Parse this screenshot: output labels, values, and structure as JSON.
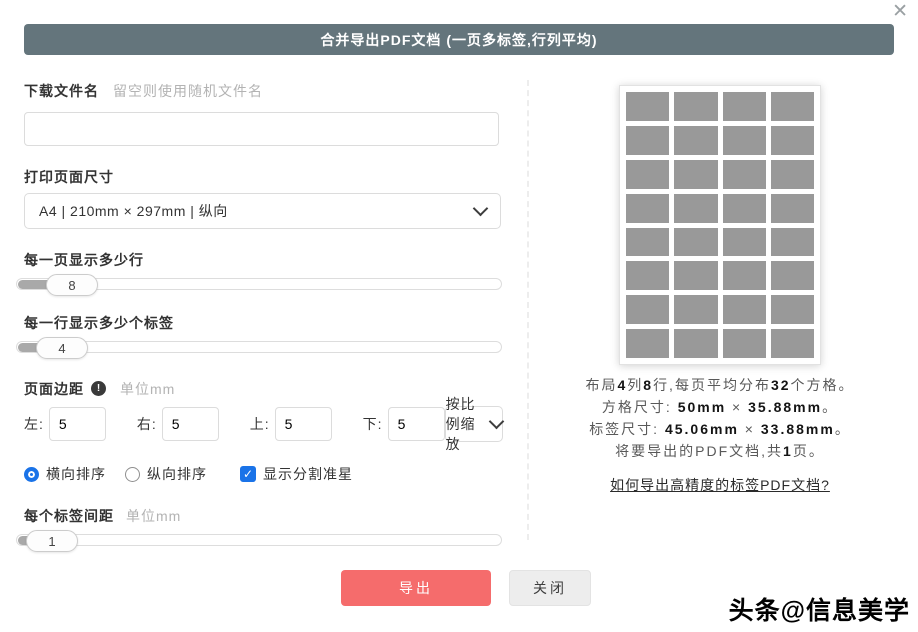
{
  "dialog": {
    "title": "合并导出PDF文档 (一页多标签,行列平均)",
    "close_icon": "✕",
    "colors": {
      "header_bg": "#64757c",
      "accent_blue": "#1a73e8",
      "danger_red": "#f56c6c",
      "grid_cell_gray": "#999999"
    }
  },
  "form": {
    "filename": {
      "label": "下载文件名",
      "hint": "留空则使用随机文件名",
      "value": ""
    },
    "page_size": {
      "label": "打印页面尺寸",
      "selected": "A4 | 210mm × 297mm | 纵向"
    },
    "rows_slider": {
      "label": "每一页显示多少行",
      "value": "8"
    },
    "cols_slider": {
      "label": "每一行显示多少个标签",
      "value": "4"
    },
    "margins": {
      "label": "页面边距",
      "info_icon": "!",
      "unit": "单位mm",
      "left_label": "左:",
      "right_label": "右:",
      "top_label": "上:",
      "bottom_label": "下:",
      "left": "5",
      "right": "5",
      "top": "5",
      "bottom": "5",
      "scale_mode": "按比例缩放"
    },
    "order": {
      "horizontal_label": "横向排序",
      "vertical_label": "纵向排序",
      "crosshair_label": "显示分割准星",
      "checkmark": "✓"
    },
    "spacing_slider": {
      "label": "每个标签间距",
      "unit": "单位mm",
      "value": "1"
    }
  },
  "preview": {
    "grid_cols": 4,
    "grid_rows": 8,
    "line1": {
      "t1": "布局",
      "b1": "4",
      "t2": "列",
      "b2": "8",
      "t3": "行,每页平均分布",
      "b3": "32",
      "t4": "个方格。"
    },
    "line2": {
      "t1": "方格尺寸: ",
      "b1": "50mm",
      "t2": " × ",
      "b2": "35.88mm",
      "t3": "。"
    },
    "line3": {
      "t1": "标签尺寸: ",
      "b1": "45.06mm",
      "t2": " × ",
      "b2": "33.88mm",
      "t3": "。"
    },
    "line4": {
      "t1": "将要导出的PDF文档,共",
      "b1": "1",
      "t2": "页。"
    },
    "link": "如何导出高精度的标签PDF文档?"
  },
  "footer": {
    "export_label": "导出",
    "close_label": "关闭"
  },
  "watermark": "头条@信息美学"
}
